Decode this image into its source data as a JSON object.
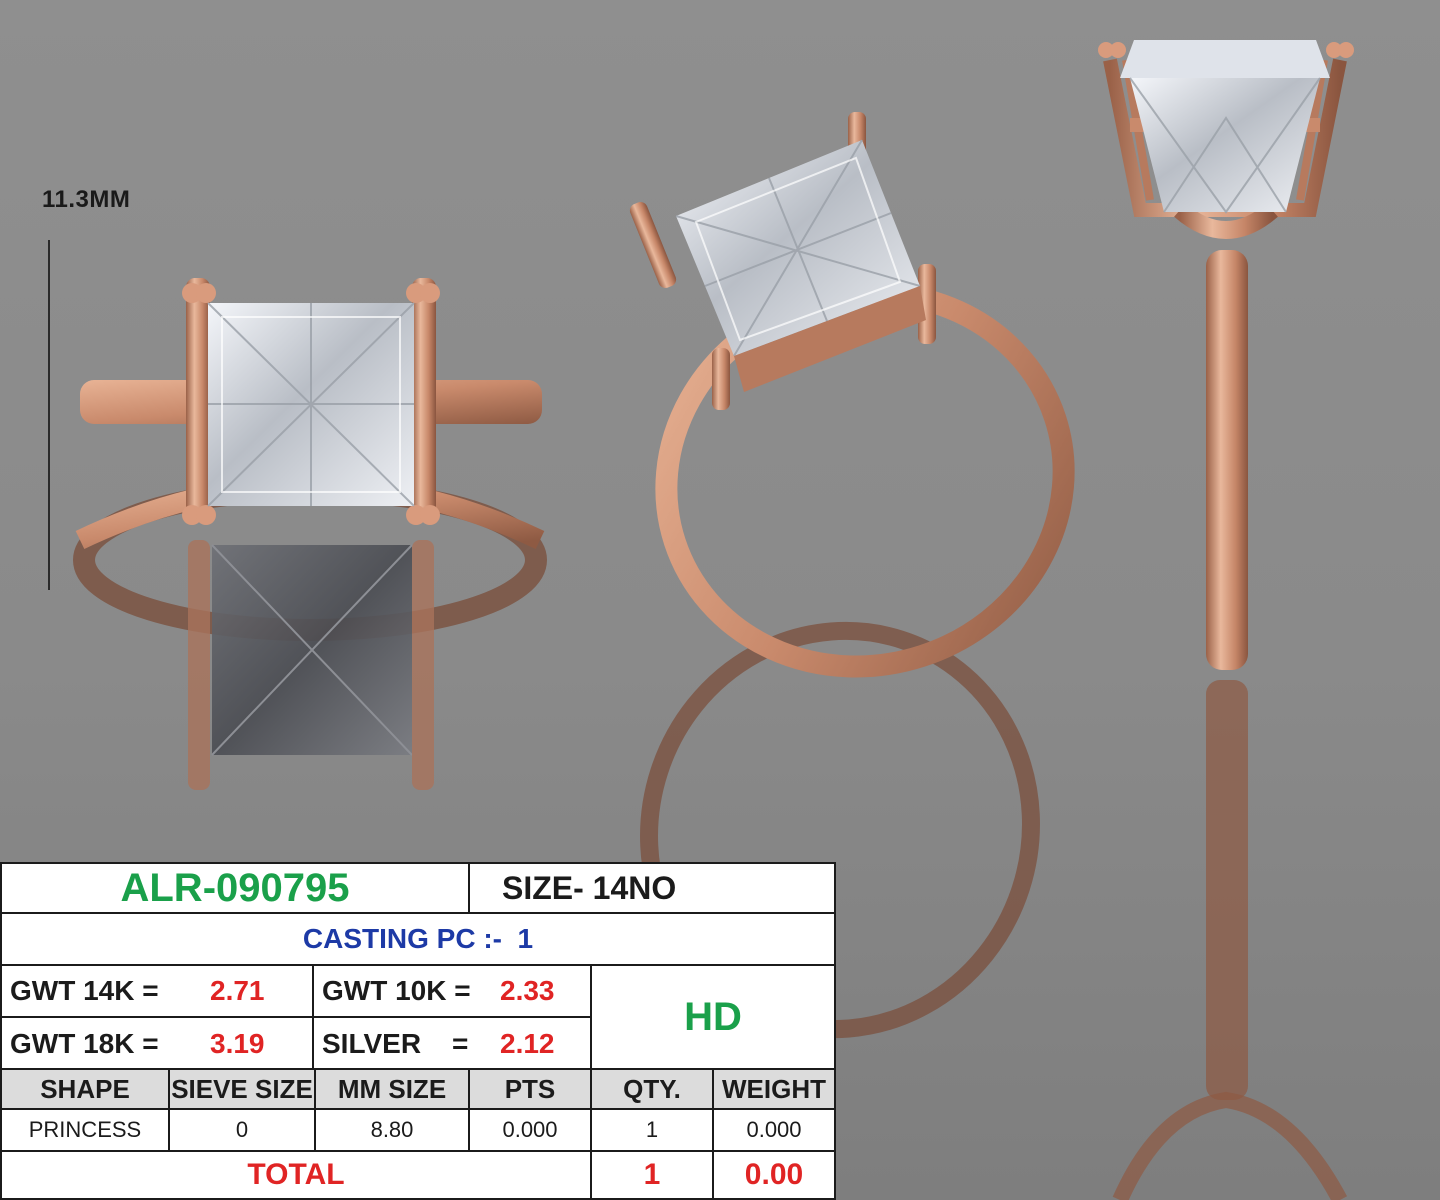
{
  "dimension_label": "11.3MM",
  "colors": {
    "rose_gold": "#c98a6c",
    "code_green": "#1aa04a",
    "value_red": "#e02424",
    "casting_blue": "#1d3aa6"
  },
  "spec": {
    "code": "ALR-090795",
    "size": "SIZE- 14NO",
    "casting_label": "CASTING PC :-",
    "casting_value": "1",
    "gwt14_label": "GWT 14K =",
    "gwt14_value": "2.71",
    "gwt10_label": "GWT 10K =",
    "gwt10_value": "2.33",
    "gwt18_label": "GWT 18K =",
    "gwt18_value": "3.19",
    "silver_label": "SILVER",
    "silver_eq": "=",
    "silver_value": "2.12",
    "quality": "HD",
    "headers": [
      "SHAPE",
      "SIEVE SIZE",
      "MM SIZE",
      "PTS",
      "QTY.",
      "WEIGHT"
    ],
    "row": [
      "PRINCESS",
      "0",
      "8.80",
      "0.000",
      "1",
      "0.000"
    ],
    "total_label": "TOTAL",
    "total_qty": "1",
    "total_weight": "0.00"
  }
}
